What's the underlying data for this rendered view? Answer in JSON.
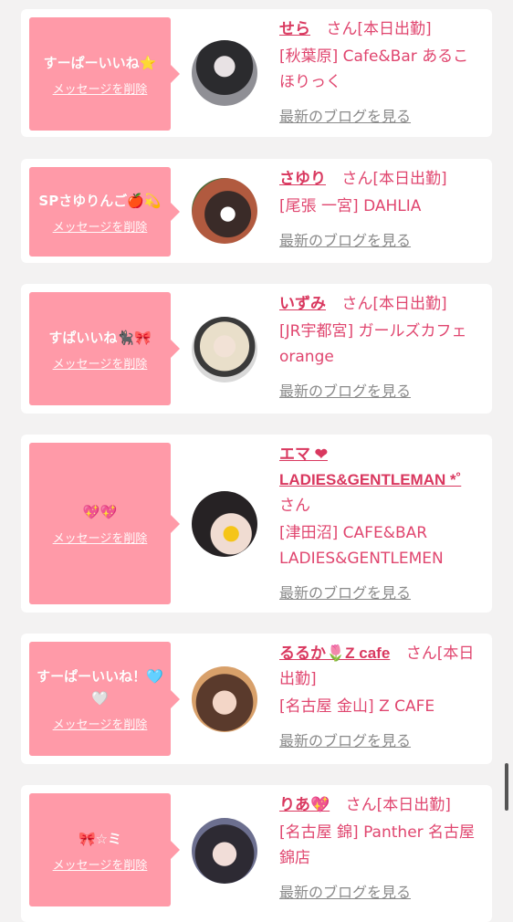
{
  "items": [
    {
      "message": "すーぱーいいね⭐",
      "delete_label": "メッセージを削除",
      "name": "せら",
      "san": "さん[本日出勤]",
      "shop": "[秋葉原] Cafe&Bar あるこほりっく",
      "blog_label": "最新のブログを見る"
    },
    {
      "message": "SPさゆりんご🍎💫",
      "delete_label": "メッセージを削除",
      "name": "さゆり",
      "san": "さん[本日出勤]",
      "shop": "[尾張 一宮] DAHLIA",
      "blog_label": "最新のブログを見る"
    },
    {
      "message": "すぱいいね🐈‍⬛🎀",
      "delete_label": "メッセージを削除",
      "name": "いずみ",
      "san": "さん[本日出勤]",
      "shop": "[JR宇都宮] ガールズカフェ orange",
      "blog_label": "最新のブログを見る"
    },
    {
      "message": "💖💖",
      "delete_label": "メッセージを削除",
      "name": "エマ ❤ LADIES&GENTLEMAN *˚",
      "san": "さん",
      "shop": "[津田沼] CAFE&BAR LADIES&GENTLEMEN",
      "blog_label": "最新のブログを見る"
    },
    {
      "message": "すーぱーいいね！🩵🤍",
      "delete_label": "メッセージを削除",
      "name": "るるか🌷Z cafe",
      "san": "さん[本日出勤]",
      "shop": "[名古屋 金山] Z CAFE",
      "blog_label": "最新のブログを見る"
    },
    {
      "message": "🎀☆ミ",
      "delete_label": "メッセージを削除",
      "name": "りあ💖",
      "san": "さん[本日出勤]",
      "shop": "[名古屋 錦] Panther 名古屋錦店",
      "blog_label": "最新のブログを見る"
    }
  ],
  "colors": {
    "bubble": "#ff9aa8",
    "accent": "#e0466f",
    "background": "#f3f2f2"
  }
}
